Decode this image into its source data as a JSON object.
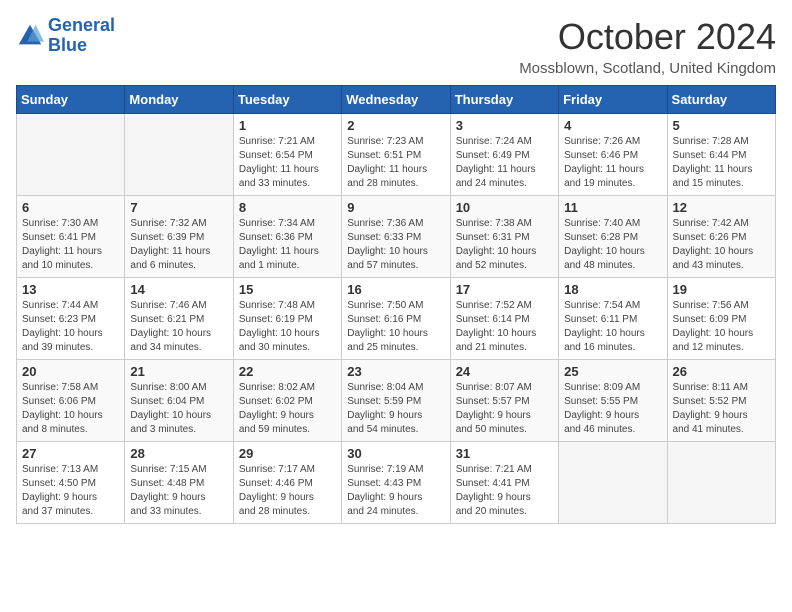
{
  "header": {
    "logo_line1": "General",
    "logo_line2": "Blue",
    "month": "October 2024",
    "location": "Mossblown, Scotland, United Kingdom"
  },
  "weekdays": [
    "Sunday",
    "Monday",
    "Tuesday",
    "Wednesday",
    "Thursday",
    "Friday",
    "Saturday"
  ],
  "weeks": [
    [
      {
        "day": "",
        "detail": ""
      },
      {
        "day": "",
        "detail": ""
      },
      {
        "day": "1",
        "detail": "Sunrise: 7:21 AM\nSunset: 6:54 PM\nDaylight: 11 hours\nand 33 minutes."
      },
      {
        "day": "2",
        "detail": "Sunrise: 7:23 AM\nSunset: 6:51 PM\nDaylight: 11 hours\nand 28 minutes."
      },
      {
        "day": "3",
        "detail": "Sunrise: 7:24 AM\nSunset: 6:49 PM\nDaylight: 11 hours\nand 24 minutes."
      },
      {
        "day": "4",
        "detail": "Sunrise: 7:26 AM\nSunset: 6:46 PM\nDaylight: 11 hours\nand 19 minutes."
      },
      {
        "day": "5",
        "detail": "Sunrise: 7:28 AM\nSunset: 6:44 PM\nDaylight: 11 hours\nand 15 minutes."
      }
    ],
    [
      {
        "day": "6",
        "detail": "Sunrise: 7:30 AM\nSunset: 6:41 PM\nDaylight: 11 hours\nand 10 minutes."
      },
      {
        "day": "7",
        "detail": "Sunrise: 7:32 AM\nSunset: 6:39 PM\nDaylight: 11 hours\nand 6 minutes."
      },
      {
        "day": "8",
        "detail": "Sunrise: 7:34 AM\nSunset: 6:36 PM\nDaylight: 11 hours\nand 1 minute."
      },
      {
        "day": "9",
        "detail": "Sunrise: 7:36 AM\nSunset: 6:33 PM\nDaylight: 10 hours\nand 57 minutes."
      },
      {
        "day": "10",
        "detail": "Sunrise: 7:38 AM\nSunset: 6:31 PM\nDaylight: 10 hours\nand 52 minutes."
      },
      {
        "day": "11",
        "detail": "Sunrise: 7:40 AM\nSunset: 6:28 PM\nDaylight: 10 hours\nand 48 minutes."
      },
      {
        "day": "12",
        "detail": "Sunrise: 7:42 AM\nSunset: 6:26 PM\nDaylight: 10 hours\nand 43 minutes."
      }
    ],
    [
      {
        "day": "13",
        "detail": "Sunrise: 7:44 AM\nSunset: 6:23 PM\nDaylight: 10 hours\nand 39 minutes."
      },
      {
        "day": "14",
        "detail": "Sunrise: 7:46 AM\nSunset: 6:21 PM\nDaylight: 10 hours\nand 34 minutes."
      },
      {
        "day": "15",
        "detail": "Sunrise: 7:48 AM\nSunset: 6:19 PM\nDaylight: 10 hours\nand 30 minutes."
      },
      {
        "day": "16",
        "detail": "Sunrise: 7:50 AM\nSunset: 6:16 PM\nDaylight: 10 hours\nand 25 minutes."
      },
      {
        "day": "17",
        "detail": "Sunrise: 7:52 AM\nSunset: 6:14 PM\nDaylight: 10 hours\nand 21 minutes."
      },
      {
        "day": "18",
        "detail": "Sunrise: 7:54 AM\nSunset: 6:11 PM\nDaylight: 10 hours\nand 16 minutes."
      },
      {
        "day": "19",
        "detail": "Sunrise: 7:56 AM\nSunset: 6:09 PM\nDaylight: 10 hours\nand 12 minutes."
      }
    ],
    [
      {
        "day": "20",
        "detail": "Sunrise: 7:58 AM\nSunset: 6:06 PM\nDaylight: 10 hours\nand 8 minutes."
      },
      {
        "day": "21",
        "detail": "Sunrise: 8:00 AM\nSunset: 6:04 PM\nDaylight: 10 hours\nand 3 minutes."
      },
      {
        "day": "22",
        "detail": "Sunrise: 8:02 AM\nSunset: 6:02 PM\nDaylight: 9 hours\nand 59 minutes."
      },
      {
        "day": "23",
        "detail": "Sunrise: 8:04 AM\nSunset: 5:59 PM\nDaylight: 9 hours\nand 54 minutes."
      },
      {
        "day": "24",
        "detail": "Sunrise: 8:07 AM\nSunset: 5:57 PM\nDaylight: 9 hours\nand 50 minutes."
      },
      {
        "day": "25",
        "detail": "Sunrise: 8:09 AM\nSunset: 5:55 PM\nDaylight: 9 hours\nand 46 minutes."
      },
      {
        "day": "26",
        "detail": "Sunrise: 8:11 AM\nSunset: 5:52 PM\nDaylight: 9 hours\nand 41 minutes."
      }
    ],
    [
      {
        "day": "27",
        "detail": "Sunrise: 7:13 AM\nSunset: 4:50 PM\nDaylight: 9 hours\nand 37 minutes."
      },
      {
        "day": "28",
        "detail": "Sunrise: 7:15 AM\nSunset: 4:48 PM\nDaylight: 9 hours\nand 33 minutes."
      },
      {
        "day": "29",
        "detail": "Sunrise: 7:17 AM\nSunset: 4:46 PM\nDaylight: 9 hours\nand 28 minutes."
      },
      {
        "day": "30",
        "detail": "Sunrise: 7:19 AM\nSunset: 4:43 PM\nDaylight: 9 hours\nand 24 minutes."
      },
      {
        "day": "31",
        "detail": "Sunrise: 7:21 AM\nSunset: 4:41 PM\nDaylight: 9 hours\nand 20 minutes."
      },
      {
        "day": "",
        "detail": ""
      },
      {
        "day": "",
        "detail": ""
      }
    ]
  ]
}
